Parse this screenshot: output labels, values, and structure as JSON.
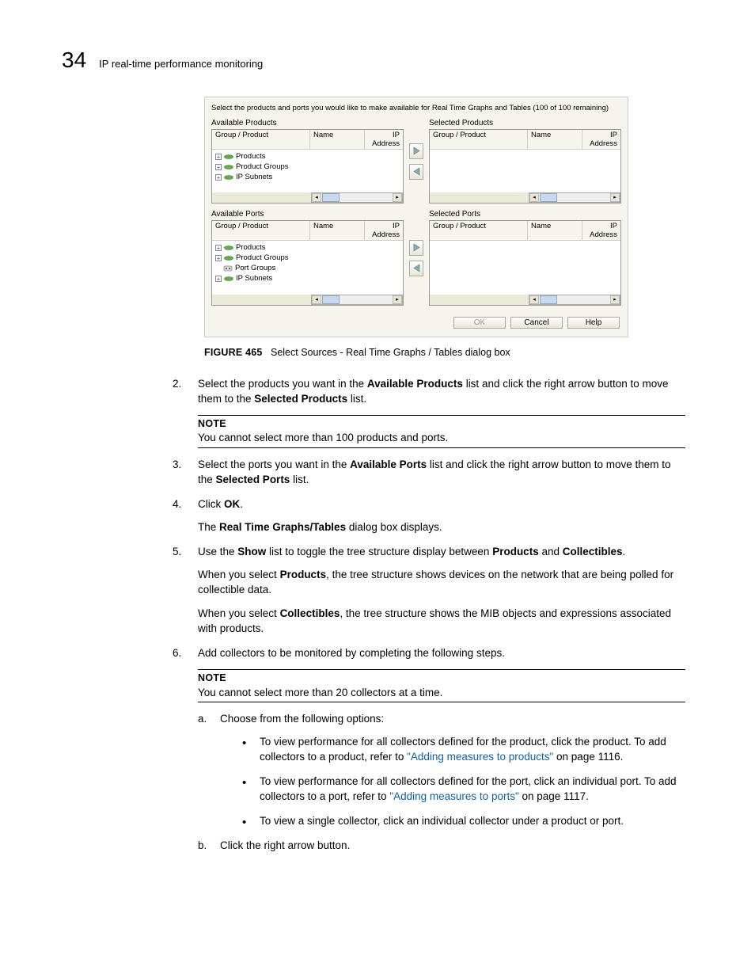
{
  "header": {
    "page_number": "34",
    "title": "IP real-time performance monitoring"
  },
  "dialog": {
    "instruction": "Select the products and ports you would like to make available for Real Time Graphs and Tables (100 of 100 remaining)",
    "available_products": {
      "title": "Available Products",
      "cols": {
        "gp": "Group / Product",
        "name": "Name",
        "ip": "IP Address"
      },
      "items": [
        "Products",
        "Product Groups",
        "IP Subnets"
      ]
    },
    "selected_products": {
      "title": "Selected Products",
      "cols": {
        "gp": "Group / Product",
        "name": "Name",
        "ip": "IP Address"
      }
    },
    "available_ports": {
      "title": "Available Ports",
      "cols": {
        "gp": "Group / Product",
        "name": "Name",
        "ip": "IP Address"
      },
      "items": [
        "Products",
        "Product Groups",
        "Port Groups",
        "IP Subnets"
      ]
    },
    "selected_ports": {
      "title": "Selected Ports",
      "cols": {
        "gp": "Group / Product",
        "name": "Name",
        "ip": "IP Address"
      }
    },
    "buttons": {
      "ok": "OK",
      "cancel": "Cancel",
      "help": "Help"
    }
  },
  "caption": {
    "label": "FIGURE 465",
    "text": "Select Sources - Real Time Graphs / Tables dialog box"
  },
  "steps": {
    "s2a": "Select the products you want in the ",
    "s2b": "Available Products",
    "s2c": " list and click the right arrow button to move them to the ",
    "s2d": "Selected Products",
    "s2e": " list.",
    "note1_label": "NOTE",
    "note1_text": "You cannot select more than 100 products and ports.",
    "s3a": "Select the ports you want in the ",
    "s3b": "Available Ports",
    "s3c": " list and click the right arrow button to move them to the ",
    "s3d": "Selected Ports",
    "s3e": " list.",
    "s4a": "Click ",
    "s4b": "OK",
    "s4c": ".",
    "s4_p1a": "The ",
    "s4_p1b": "Real Time Graphs/Tables",
    "s4_p1c": " dialog box displays.",
    "s5a": "Use the ",
    "s5b": "Show",
    "s5c": " list to toggle the tree structure display between ",
    "s5d": "Products",
    "s5e": " and ",
    "s5f": "Collectibles",
    "s5g": ".",
    "s5_p1a": "When you select ",
    "s5_p1b": "Products",
    "s5_p1c": ", the tree structure shows devices on the network that are being polled for collectible data.",
    "s5_p2a": "When you select ",
    "s5_p2b": "Collectibles",
    "s5_p2c": ", the tree structure shows the MIB objects and expressions associated with products.",
    "s6": "Add collectors to be monitored by completing the following steps.",
    "note2_label": "NOTE",
    "note2_text": "You cannot select more than 20 collectors at a time.",
    "sa_marker": "a.",
    "sa_text": "Choose from the following options:",
    "b1a": "To view performance for all collectors defined for the product, click the product. To add collectors to a product, refer to ",
    "b1_link": "\"Adding measures to products\"",
    "b1b": " on page 1116.",
    "b2a": "To view performance for all collectors defined for the port, click an individual port. To add collectors to a port, refer to ",
    "b2_link": "\"Adding measures to ports\"",
    "b2b": " on page 1117.",
    "b3": "To view a single collector, click an individual collector under a product or port.",
    "sb_marker": "b.",
    "sb_text": "Click the right arrow button."
  }
}
